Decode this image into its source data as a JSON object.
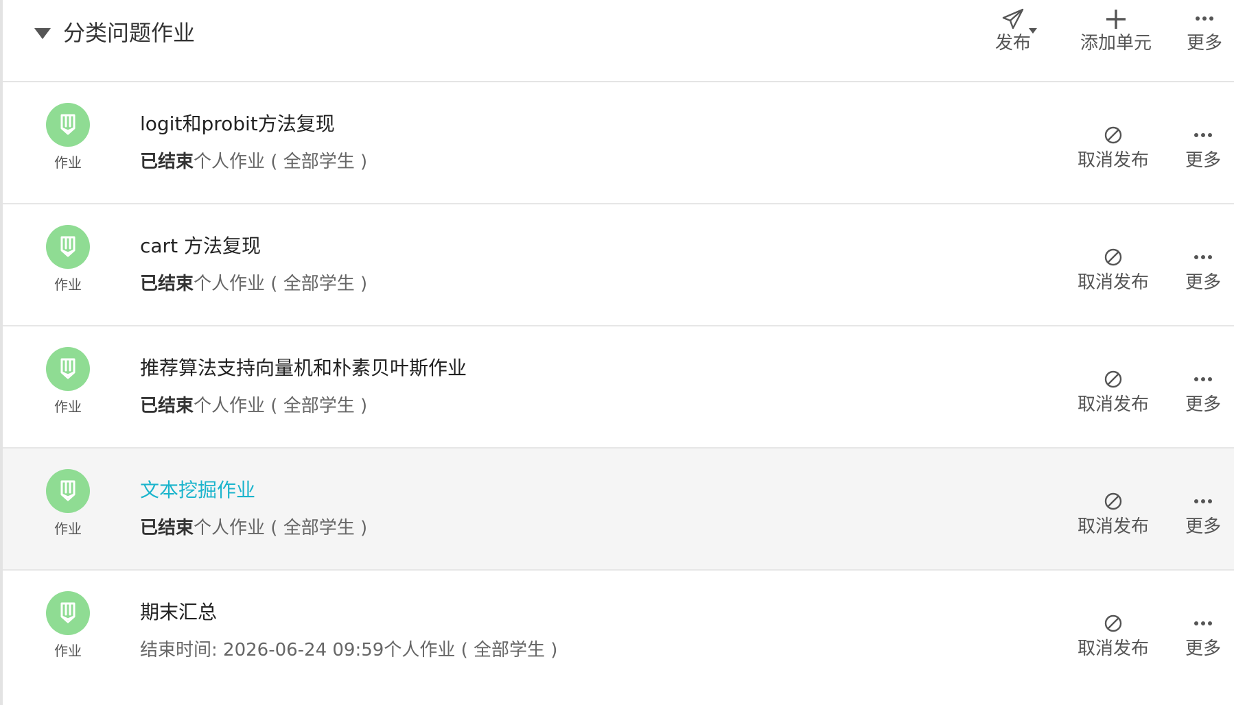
{
  "unit": {
    "title": "分类问题作业",
    "actions": {
      "publish": "发布",
      "add_unit": "添加单元",
      "more": "更多"
    }
  },
  "icons": {
    "badge_color": "#8fdc93",
    "link_color": "#1ab4cc"
  },
  "items": [
    {
      "title": "logit和probit方法复现",
      "badge_label": "作业",
      "status": "已结束",
      "meta": "个人作业 ( 全部学生 )",
      "unpublish_label": "取消发布",
      "more_label": "更多"
    },
    {
      "title": "cart 方法复现",
      "badge_label": "作业",
      "status": "已结束",
      "meta": "个人作业 ( 全部学生 )",
      "unpublish_label": "取消发布",
      "more_label": "更多"
    },
    {
      "title": "推荐算法支持向量机和朴素贝叶斯作业",
      "badge_label": "作业",
      "status": "已结束",
      "meta": "个人作业 ( 全部学生 )",
      "unpublish_label": "取消发布",
      "more_label": "更多"
    },
    {
      "title": "文本挖掘作业",
      "badge_label": "作业",
      "status": "已结束",
      "meta": "个人作业 ( 全部学生 )",
      "unpublish_label": "取消发布",
      "more_label": "更多"
    },
    {
      "title": "期末汇总",
      "badge_label": "作业",
      "status": "",
      "meta": "结束时间: 2026-06-24 09:59个人作业 ( 全部学生 )",
      "unpublish_label": "取消发布",
      "more_label": "更多"
    }
  ]
}
